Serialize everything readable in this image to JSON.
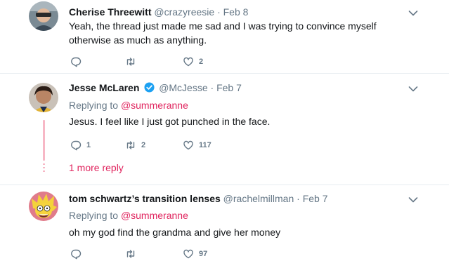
{
  "tweets": [
    {
      "name": "Cherise Threewitt",
      "handle": "@crazyreesie",
      "separator": "·",
      "date": "Feb 8",
      "lines": [
        "Yeah, the thread just made me sad and I was trying to convince myself",
        "otherwise as much as anything."
      ],
      "likes": "2"
    },
    {
      "name": "Jesse McLaren",
      "handle": "@McJesse",
      "separator": "·",
      "date": "Feb 7",
      "replying_prefix": "Replying to",
      "replying_to": "@summeranne",
      "text": "Jesus. I feel like I just got punched in the face.",
      "replies": "1",
      "retweets": "2",
      "likes": "117",
      "more_reply": "1 more reply"
    },
    {
      "name": "tom schwartz’s transition lenses",
      "handle": "@rachelmillman",
      "separator": "·",
      "date": "Feb 7",
      "replying_prefix": "Replying to",
      "replying_to": "@summeranne",
      "text": "oh my god find the grandma and give her money",
      "likes": "97"
    }
  ],
  "colors": {
    "accent": "#e0245e",
    "secondary": "#657786",
    "verified": "#1da1f2",
    "thread": "#f7b8c6"
  },
  "icons": [
    "reply-icon",
    "retweet-icon",
    "like-icon",
    "chevron-down-icon",
    "verified-badge-icon"
  ]
}
